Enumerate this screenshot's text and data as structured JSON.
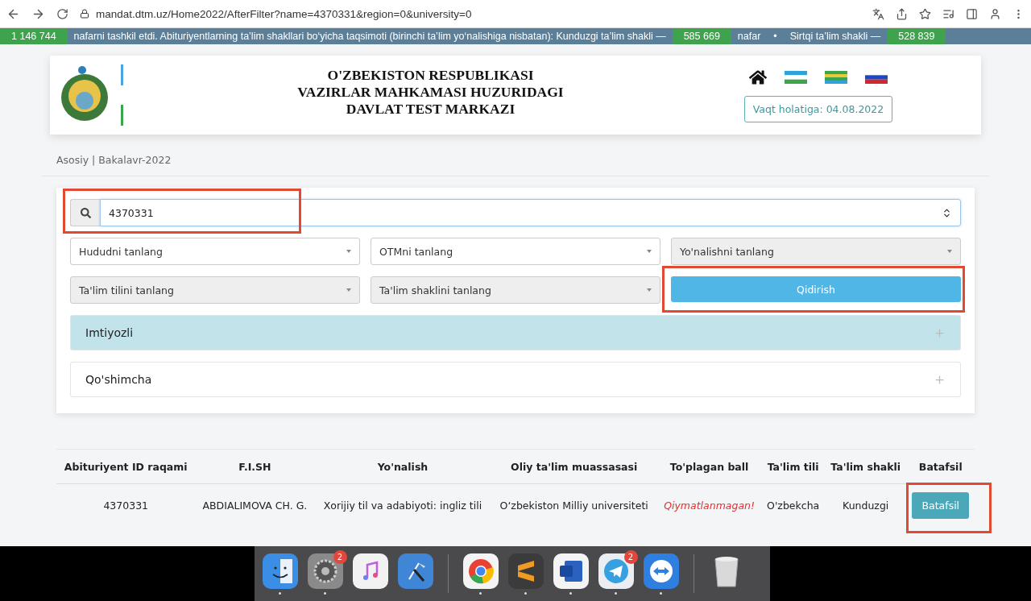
{
  "browser": {
    "url": "mandat.dtm.uz/Home2022/AfterFilter?name=4370331&region=0&university=0"
  },
  "ticker": [
    {
      "kind": "number",
      "text": "1 146 744"
    },
    {
      "kind": "text",
      "text": "nafarni tashkil etdi. Abituriyentlarning ta’lim shakllari bo‘yicha taqsimoti (birinchi ta’lim yo‘nalishiga nisbatan): Kunduzgi ta’lim shakli —"
    },
    {
      "kind": "number",
      "text": "585 669"
    },
    {
      "kind": "text",
      "text": "nafar"
    },
    {
      "kind": "text",
      "text": "•"
    },
    {
      "kind": "text",
      "text": "Sirtqi ta’lim shakli —"
    },
    {
      "kind": "number",
      "text": "528 839"
    }
  ],
  "header": {
    "title": [
      "O'ZBEKISTON RESPUBLIKASI",
      "VAZIRLAR MAHKAMASI HUZURIDAGI",
      "DAVLAT TEST MARKAZI"
    ],
    "date_button": "Vaqt holatiga: 04.08.2022"
  },
  "breadcrumb": "Asosiy | Bakalavr-2022",
  "search": {
    "value": "4370331",
    "highlighted": true
  },
  "selects": [
    {
      "placeholder": "Hududni tanlang",
      "disabled": false
    },
    {
      "placeholder": "OTMni tanlang",
      "disabled": false
    },
    {
      "placeholder": "Yo'nalishni tanlang",
      "disabled": true
    },
    {
      "placeholder": "Ta'lim tilini tanlang",
      "disabled": true
    },
    {
      "placeholder": "Ta'lim shaklini tanlang",
      "disabled": true
    }
  ],
  "search_button": {
    "label": "Qidirish",
    "highlighted": true
  },
  "accordion": [
    {
      "title": "Imtiyozli",
      "active": true
    },
    {
      "title": "Qo'shimcha",
      "active": false
    }
  ],
  "table": {
    "columns": [
      "Abituriyent ID raqami",
      "F.I.SH",
      "Yo'nalish",
      "Oliy ta'lim muassasasi",
      "To'plagan ball",
      "Ta'lim tili",
      "Ta'lim shakli",
      "Batafsil"
    ],
    "rows": [
      {
        "cells": [
          {
            "text": "4370331",
            "kind": "plain"
          },
          {
            "text": "ABDIALIMOVA CH. G.",
            "kind": "plain"
          },
          {
            "text": "Xorijiy til va adabiyoti: ingliz tili",
            "kind": "plain"
          },
          {
            "text": "O‘zbekiston Milliy universiteti",
            "kind": "plain"
          },
          {
            "text": "Qiymatlanmagan!",
            "kind": "alert"
          },
          {
            "text": "O'zbekcha",
            "kind": "plain"
          },
          {
            "text": "Kunduzgi",
            "kind": "plain"
          }
        ],
        "button": "Batafsil",
        "highlighted": true
      }
    ]
  },
  "dock": [
    {
      "kind": "finder",
      "running": true
    },
    {
      "kind": "settings",
      "running": true,
      "badge": "2"
    },
    {
      "kind": "music",
      "running": false
    },
    {
      "kind": "xcode",
      "running": false
    },
    {
      "kind": "separator"
    },
    {
      "kind": "chrome",
      "running": true
    },
    {
      "kind": "sublime",
      "running": true
    },
    {
      "kind": "word",
      "running": true
    },
    {
      "kind": "telegram",
      "running": true,
      "badge": "2"
    },
    {
      "kind": "teamviewer",
      "running": true
    },
    {
      "kind": "separator"
    },
    {
      "kind": "trash",
      "running": false
    }
  ]
}
